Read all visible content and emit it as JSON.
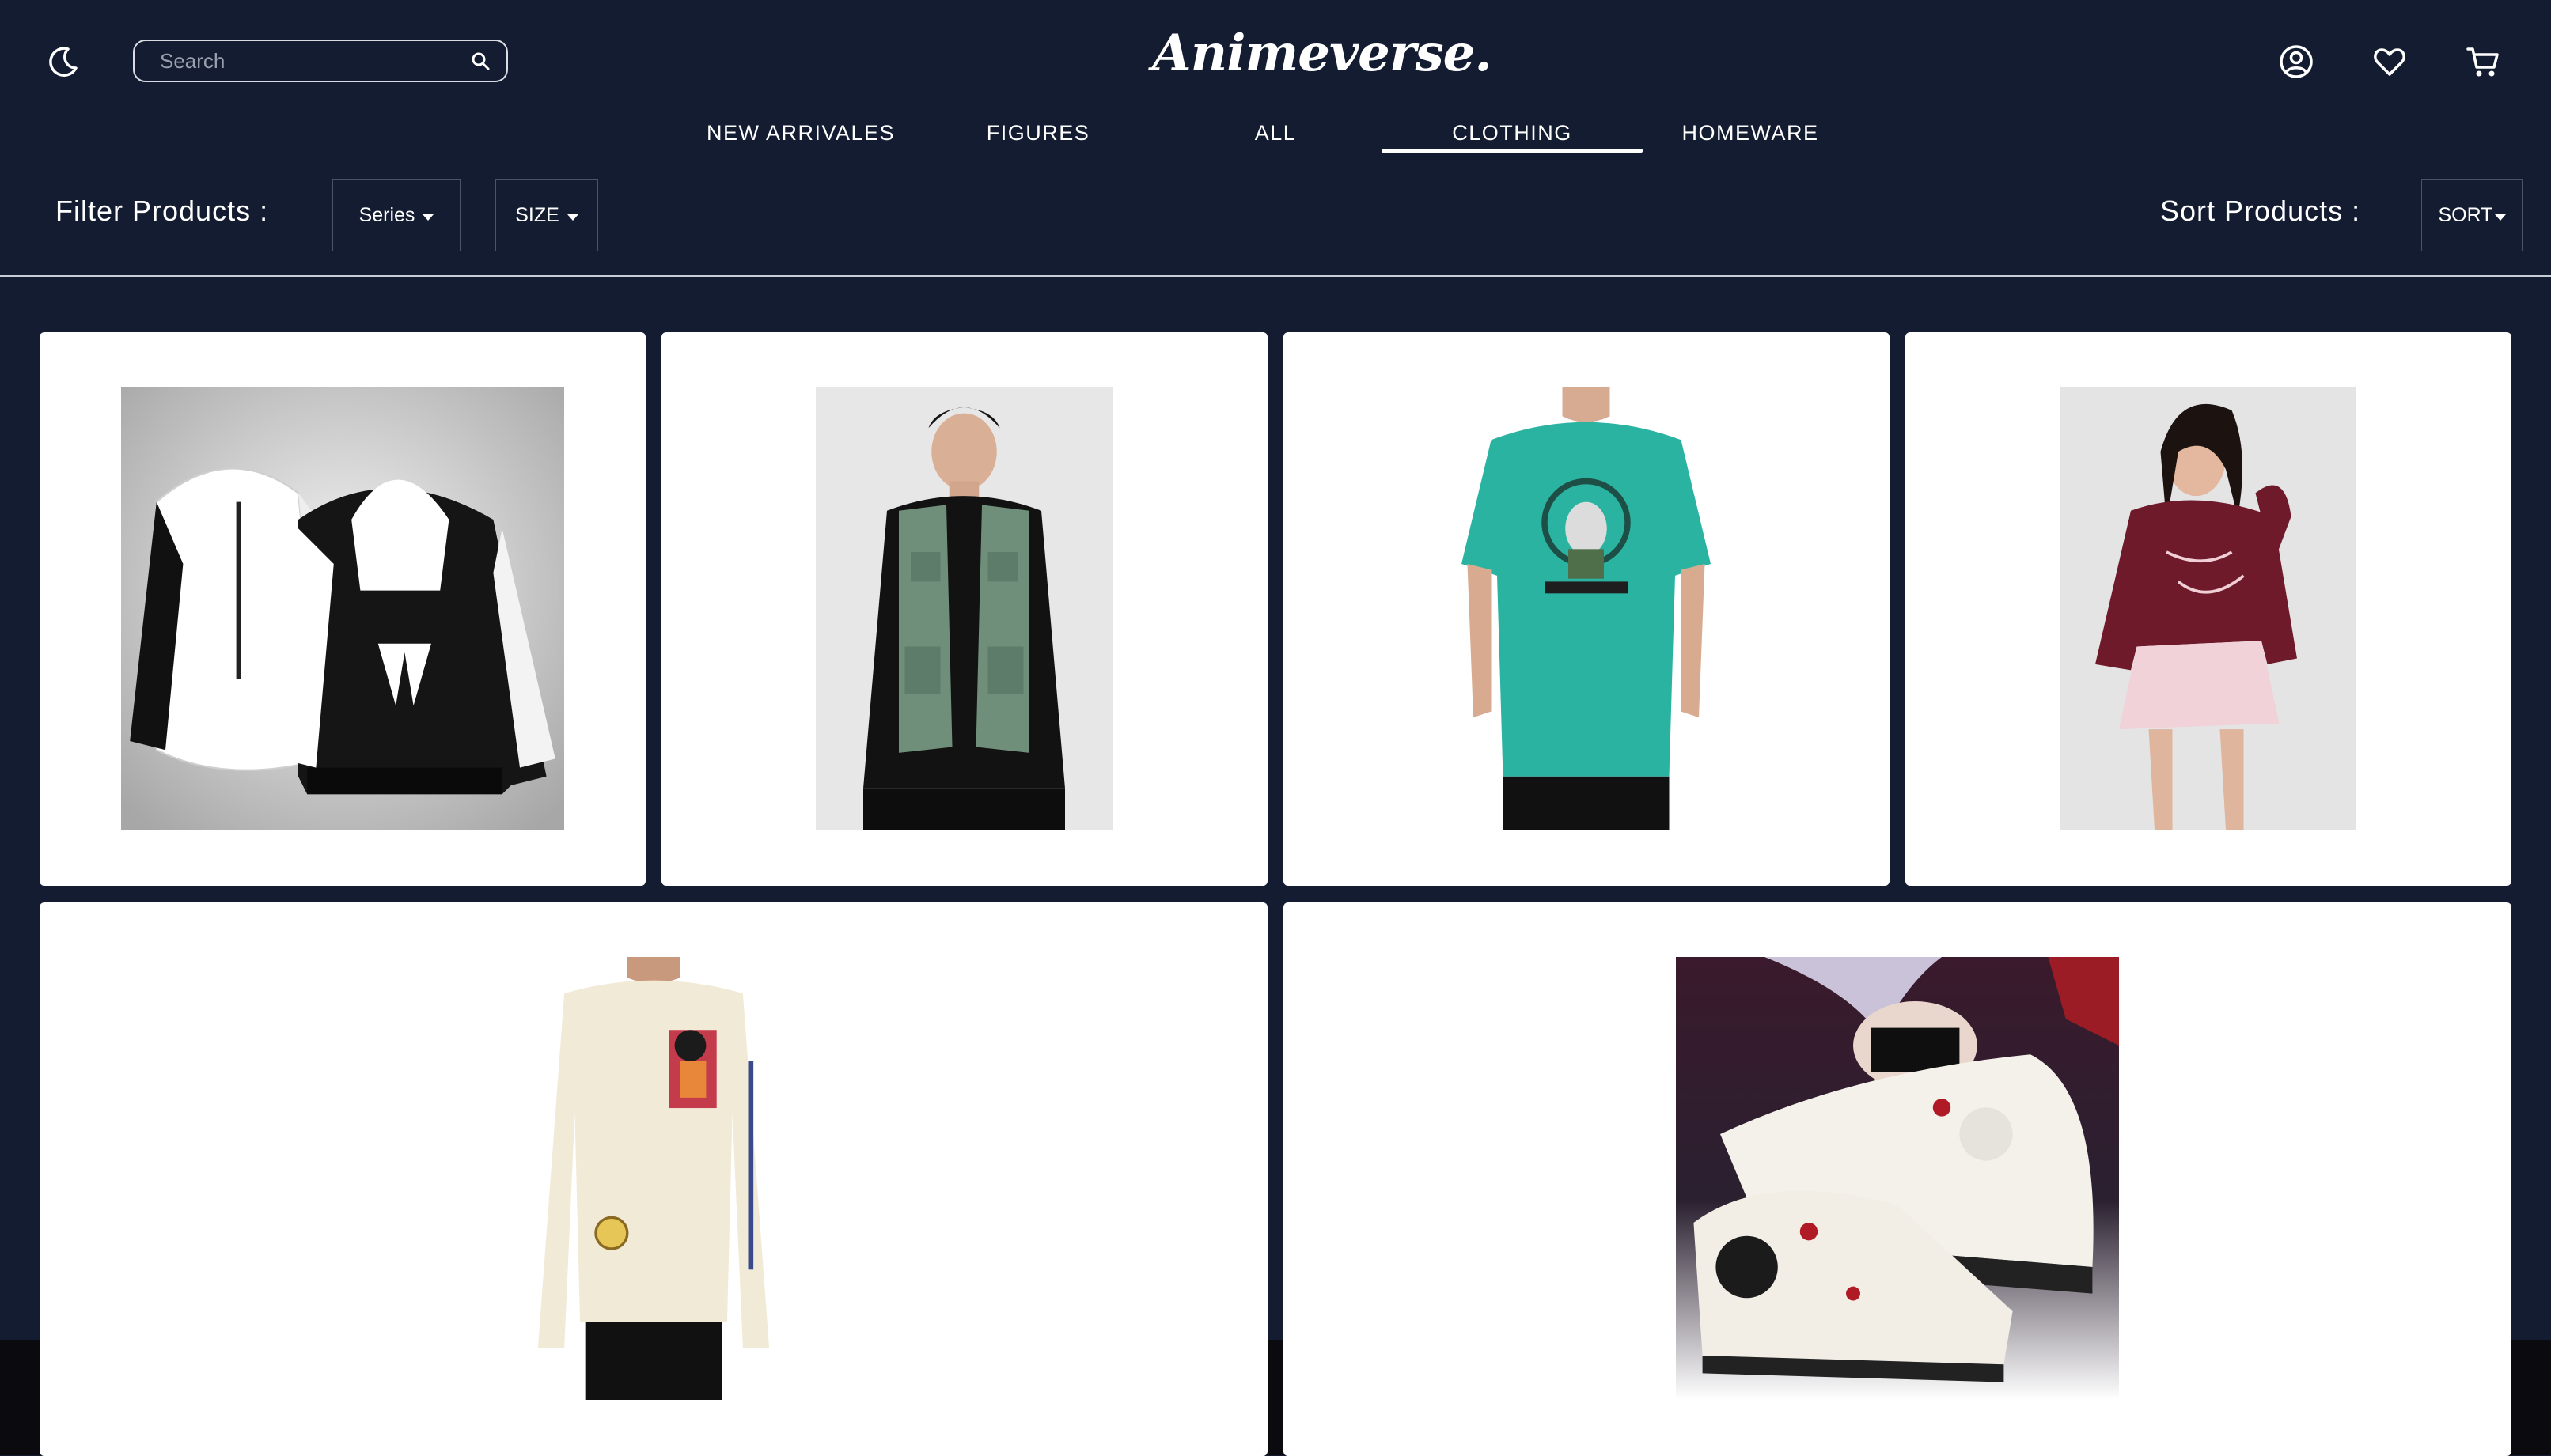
{
  "header": {
    "theme_icon": "moon-icon",
    "search": {
      "placeholder": "Search",
      "value": "",
      "icon": "search-icon"
    },
    "logo": "Animeverse.",
    "icons": [
      "user-circle-icon",
      "heart-icon",
      "cart-icon"
    ]
  },
  "nav": {
    "items": [
      "NEW ARRIVALES",
      "FIGURES",
      "ALL",
      "CLOTHING",
      "HOMEWARE"
    ],
    "active": "CLOTHING"
  },
  "filters": {
    "label": "Filter Products :",
    "series_label": "Series",
    "size_label": "SIZE",
    "sort_label": "Sort Products :",
    "sort_button": "SORT"
  },
  "products": [
    {
      "image": "Black and white hooded jacket with Survey Corps wings emblem"
    },
    {
      "image": "Model wearing green utility vest over black long-sleeve shirt"
    },
    {
      "image": "Teal t-shirt with Kakashi graphic"
    },
    {
      "image": "Model in maroon sweatshirt and pink pleated skirt"
    },
    {
      "image": "Cream long-sleeve shirt with Goku graphic"
    },
    {
      "image": "Tokyo Ghoul printed high-top sneakers"
    }
  ],
  "colors": {
    "background": "#141c31",
    "card": "#ffffff",
    "text": "#ffffff",
    "border": "#4b5266"
  }
}
